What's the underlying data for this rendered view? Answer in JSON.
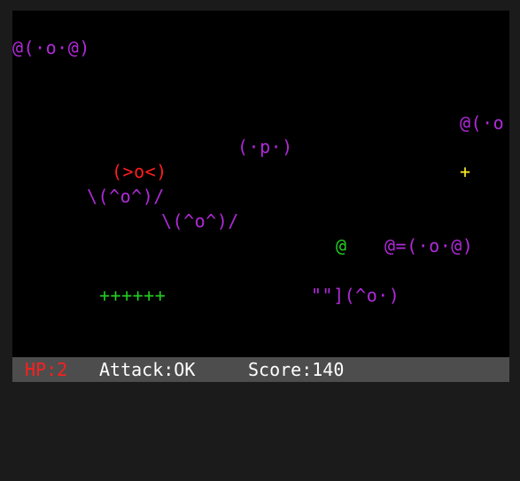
{
  "colors": {
    "monster": "#b02ad8",
    "hostile": "#ff1e1e",
    "player": "#22cc22",
    "pickup": "#ffee22",
    "hp": "#ff1e1e",
    "status_text": "#ffffff",
    "status_bg": "#4d4d4d",
    "playfield_bg": "#000000"
  },
  "entities": {
    "monster_1": "@(·o·@)",
    "monster_2": "@(·o",
    "monster_3": "(·p·)",
    "hostile_1": "(>o<)",
    "monster_4": "\\(^o^)/",
    "monster_5": "\\(^o^)/",
    "player": "@",
    "monster_6": "@=(·o·@)",
    "pickup_1": "+",
    "health_bar": "++++++",
    "monster_7": "\"\"](^o·)"
  },
  "status": {
    "hp": "HP:2",
    "attack": "Attack:OK",
    "score": "Score:140"
  }
}
